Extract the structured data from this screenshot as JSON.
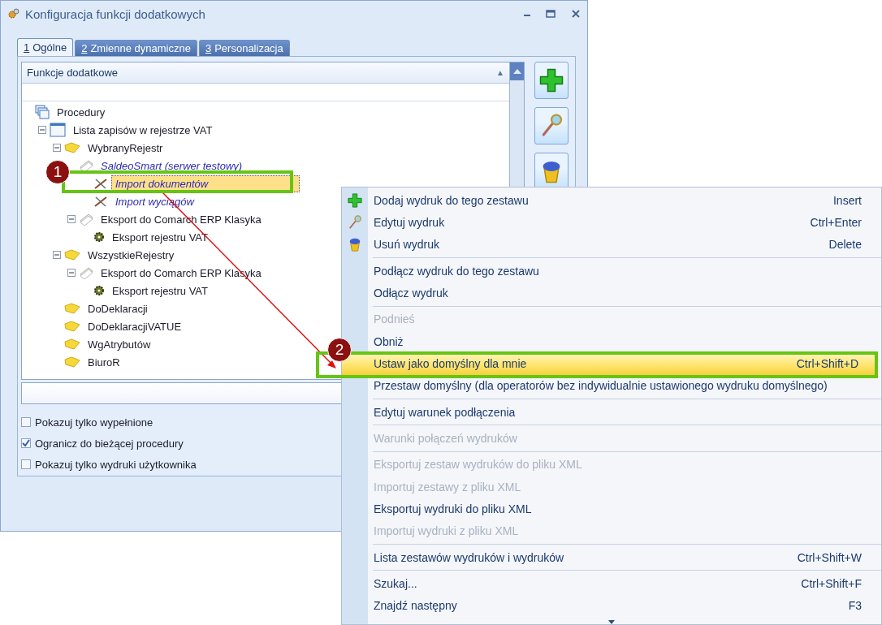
{
  "window": {
    "title": "Konfiguracja funkcji dodatkowych"
  },
  "tabs": [
    {
      "mnemonic": "1",
      "label": "Ogólne",
      "selected": true
    },
    {
      "mnemonic": "2",
      "label": "Zmienne dynamiczne",
      "selected": false
    },
    {
      "mnemonic": "3",
      "label": "Personalizacja",
      "selected": false
    }
  ],
  "list": {
    "header": "Funkcje dodatkowe",
    "sort_arrow": "▲"
  },
  "tree": [
    {
      "label": "Procedury",
      "kind": "procedures",
      "italic": false,
      "selected": false,
      "children": [
        {
          "label": "Lista zapisów w rejestrze VAT",
          "kind": "window",
          "italic": false,
          "selected": false,
          "expanded": true,
          "children": [
            {
              "label": "WybranyRejestr",
              "kind": "folder",
              "italic": false,
              "selected": false,
              "expanded": true,
              "children": [
                {
                  "label": "SaldeoSmart (serwer testowy)",
                  "kind": "pages",
                  "italic": true,
                  "selected": false,
                  "children": [
                    {
                      "label": "Import dokumentów",
                      "kind": "tools",
                      "italic": true,
                      "selected": true
                    },
                    {
                      "label": "Import wyciągów",
                      "kind": "tools",
                      "italic": true,
                      "selected": false
                    }
                  ]
                },
                {
                  "label": "Eksport do Comarch ERP Klasyka",
                  "kind": "pages",
                  "italic": false,
                  "selected": false,
                  "expanded": true,
                  "children": [
                    {
                      "label": "Eksport rejestru VAT",
                      "kind": "gear",
                      "italic": false,
                      "selected": false
                    }
                  ]
                }
              ]
            },
            {
              "label": "WszystkieRejestry",
              "kind": "folder",
              "italic": false,
              "selected": false,
              "expanded": true,
              "children": [
                {
                  "label": "Eksport do Comarch ERP Klasyka",
                  "kind": "pages",
                  "italic": false,
                  "selected": false,
                  "expanded": true,
                  "children": [
                    {
                      "label": "Eksport rejestru VAT",
                      "kind": "gear",
                      "italic": false,
                      "selected": false
                    }
                  ]
                }
              ]
            },
            {
              "label": "DoDeklaracji",
              "kind": "folder",
              "italic": false,
              "selected": false
            },
            {
              "label": "DoDeklaracjiVATUE",
              "kind": "folder",
              "italic": false,
              "selected": false
            },
            {
              "label": "WgAtrybutów",
              "kind": "folder",
              "italic": false,
              "selected": false
            },
            {
              "label": "BiuroR",
              "kind": "folder",
              "italic": false,
              "selected": false
            }
          ]
        }
      ]
    }
  ],
  "options": [
    {
      "label": "Pokazuj tylko wypełnione",
      "checked": false
    },
    {
      "label": "Ogranicz do bieżącej procedury",
      "checked": true
    },
    {
      "label": "Pokazuj tylko wydruki użytkownika",
      "checked": false
    }
  ],
  "side_buttons": [
    {
      "kind": "add"
    },
    {
      "kind": "edit"
    },
    {
      "kind": "delete"
    }
  ],
  "menu": {
    "groups": [
      [
        {
          "label": "Dodaj wydruk do tego zestawu",
          "shortcut": "Insert",
          "kind": "add",
          "disabled": false,
          "selected": false
        },
        {
          "label": "Edytuj wydruk",
          "shortcut": "Ctrl+Enter",
          "kind": "edit",
          "disabled": false,
          "selected": false
        },
        {
          "label": "Usuń wydruk",
          "shortcut": "Delete",
          "kind": "delete",
          "disabled": false,
          "selected": false
        }
      ],
      [
        {
          "label": "Podłącz wydruk do tego zestawu",
          "disabled": false,
          "selected": false
        },
        {
          "label": "Odłącz wydruk",
          "disabled": false,
          "selected": false
        }
      ],
      [
        {
          "label": "Podnieś",
          "disabled": true,
          "selected": false
        },
        {
          "label": "Obniż",
          "disabled": false,
          "selected": false
        },
        {
          "label": "Ustaw jako domyślny dla mnie",
          "shortcut": "Ctrl+Shift+D",
          "disabled": false,
          "selected": true
        },
        {
          "label": "Przestaw domyślny (dla operatorów bez indywidualnie ustawionego wydruku domyślnego)",
          "disabled": false,
          "selected": false
        }
      ],
      [
        {
          "label": "Edytuj warunek podłączenia",
          "disabled": false,
          "selected": false
        }
      ],
      [
        {
          "label": "Warunki połączeń wydruków",
          "disabled": true,
          "selected": false
        }
      ],
      [
        {
          "label": "Eksportuj zestaw wydruków do pliku XML",
          "disabled": true,
          "selected": false
        },
        {
          "label": "Importuj zestawy z pliku XML",
          "disabled": true,
          "selected": false
        },
        {
          "label": "Eksportuj wydruki do pliku XML",
          "disabled": false,
          "selected": false
        },
        {
          "label": "Importuj wydruki z pliku XML",
          "disabled": true,
          "selected": false
        }
      ],
      [
        {
          "label": "Lista zestawów wydruków i wydruków",
          "shortcut": "Ctrl+Shift+W",
          "disabled": false,
          "selected": false
        }
      ],
      [
        {
          "label": "Szukaj...",
          "shortcut": "Ctrl+Shift+F",
          "disabled": false,
          "selected": false
        },
        {
          "label": "Znajdź następny",
          "shortcut": "F3",
          "disabled": false,
          "selected": false
        }
      ]
    ]
  },
  "annotations": [
    {
      "label": "1"
    },
    {
      "label": "2"
    }
  ]
}
